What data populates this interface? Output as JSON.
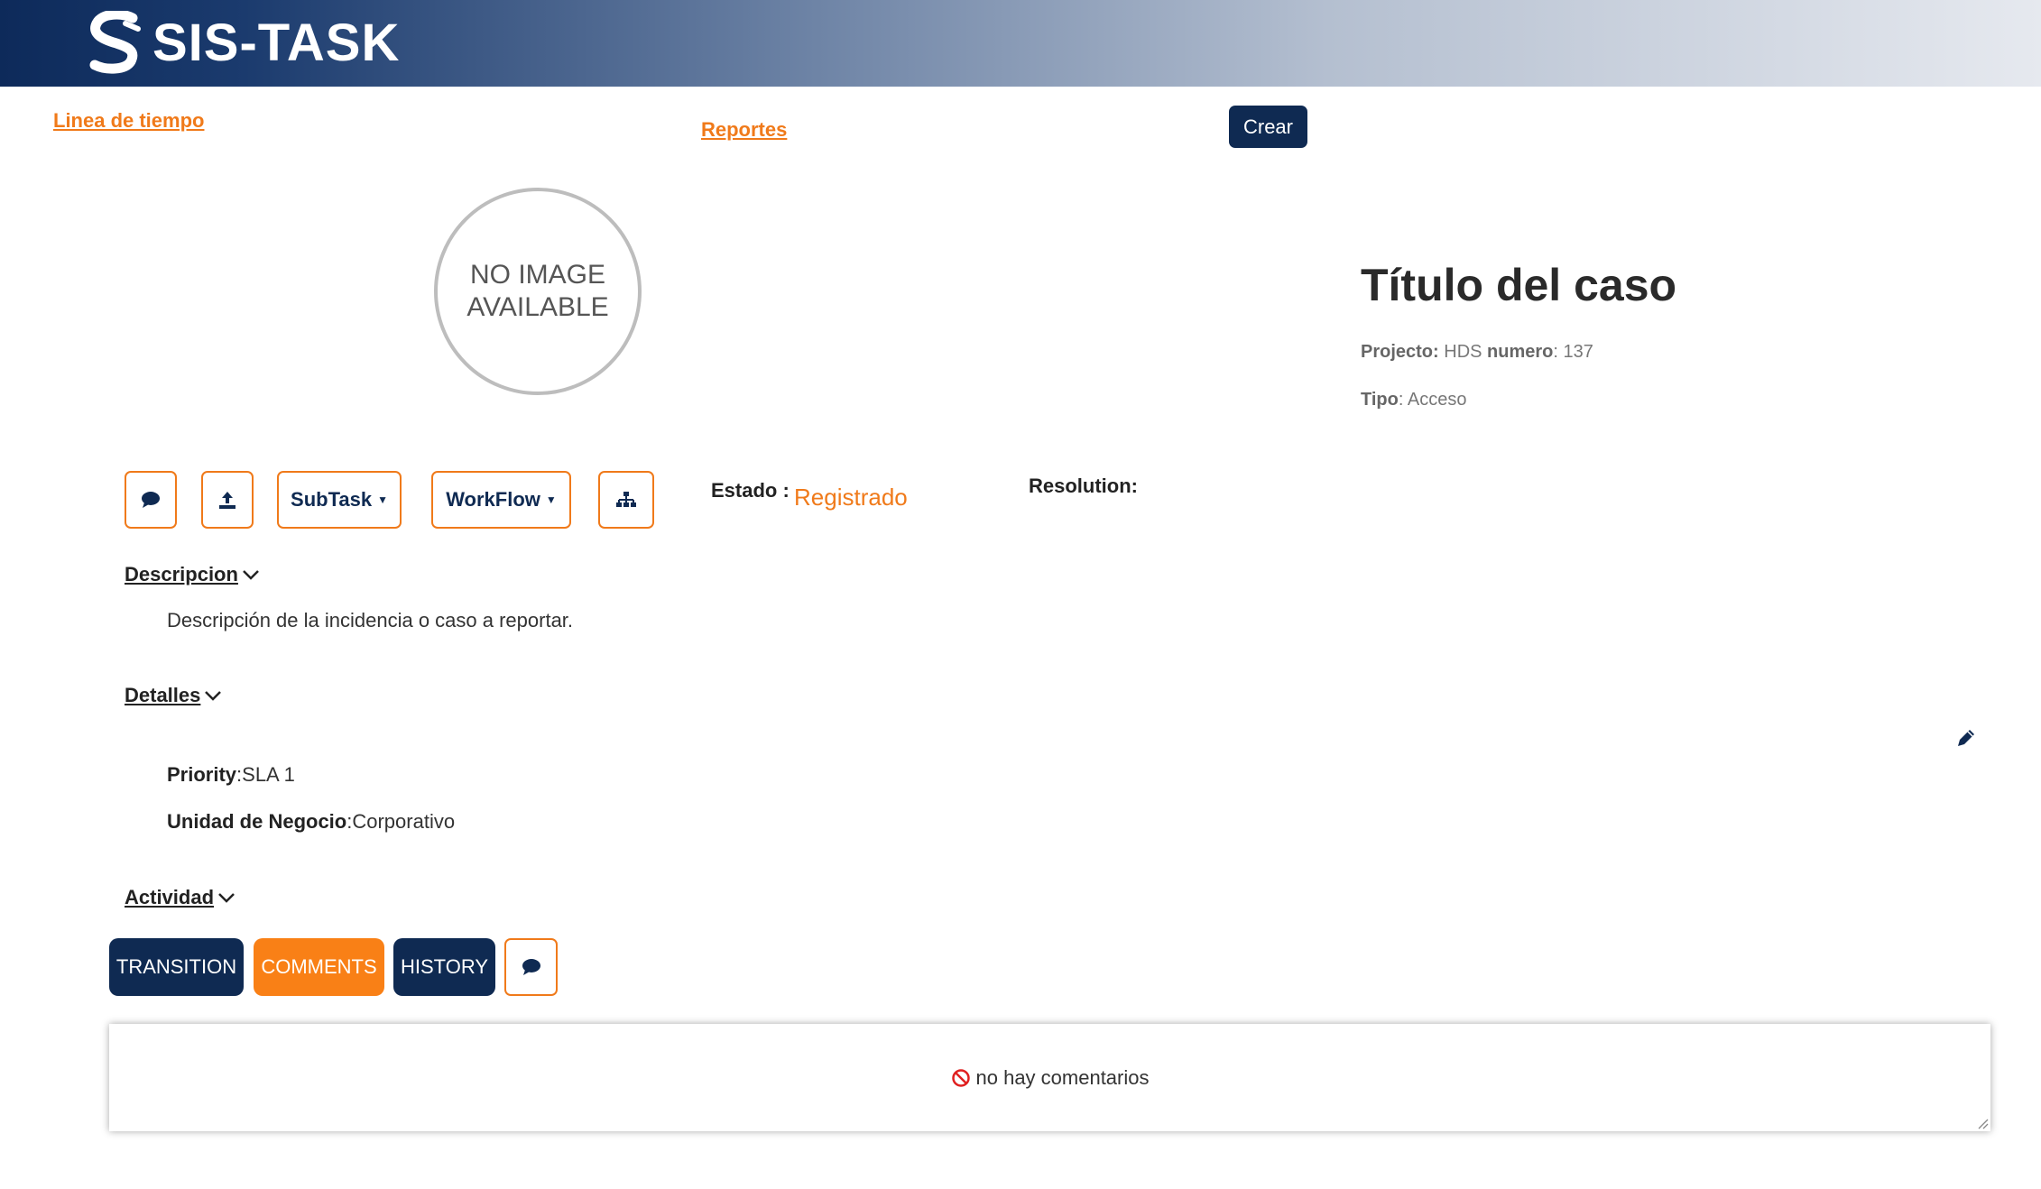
{
  "header": {
    "app_name": "SIS-TASK",
    "brand_color": "#0d2a5a",
    "logo_icon": "sis-logo-icon"
  },
  "nav": {
    "timeline_link": "Linea de tiempo",
    "reports_link": "Reportes",
    "create_button": "Crear"
  },
  "case": {
    "image_placeholder": "NO IMAGE\nAVAILABLE",
    "title": "Título del caso",
    "project_label": "Projecto:",
    "project_value": "HDS",
    "number_label": "numero",
    "number_value": ": 137",
    "type_label": "Tipo",
    "type_value": ": Acceso"
  },
  "toolbar": {
    "comment_icon": "comment-icon",
    "upload_icon": "upload-icon",
    "subtask_label": "SubTask",
    "workflow_label": "WorkFlow",
    "hierarchy_icon": "sitemap-icon",
    "accent_color": "#f07a1a"
  },
  "status": {
    "estado_label": "Estado :",
    "estado_value": "Registrado",
    "resolution_label": "Resolution:"
  },
  "description": {
    "heading": "Descripcion",
    "text": "Descripción de la incidencia o caso a reportar."
  },
  "details": {
    "heading": "Detalles",
    "priority_label": "Priority",
    "priority_value": ":SLA 1",
    "unit_label": "Unidad de Negocio",
    "unit_value": ":Corporativo",
    "edit_icon": "pencil-icon"
  },
  "activity": {
    "heading": "Actividad",
    "tabs": [
      {
        "label": "TRANSITION"
      },
      {
        "label": "COMMENTS"
      },
      {
        "label": "HISTORY"
      }
    ],
    "active_tab": "COMMENTS",
    "add_comment_icon": "comment-icon",
    "empty_message": "no hay comentarios",
    "empty_icon": "ban-icon"
  }
}
